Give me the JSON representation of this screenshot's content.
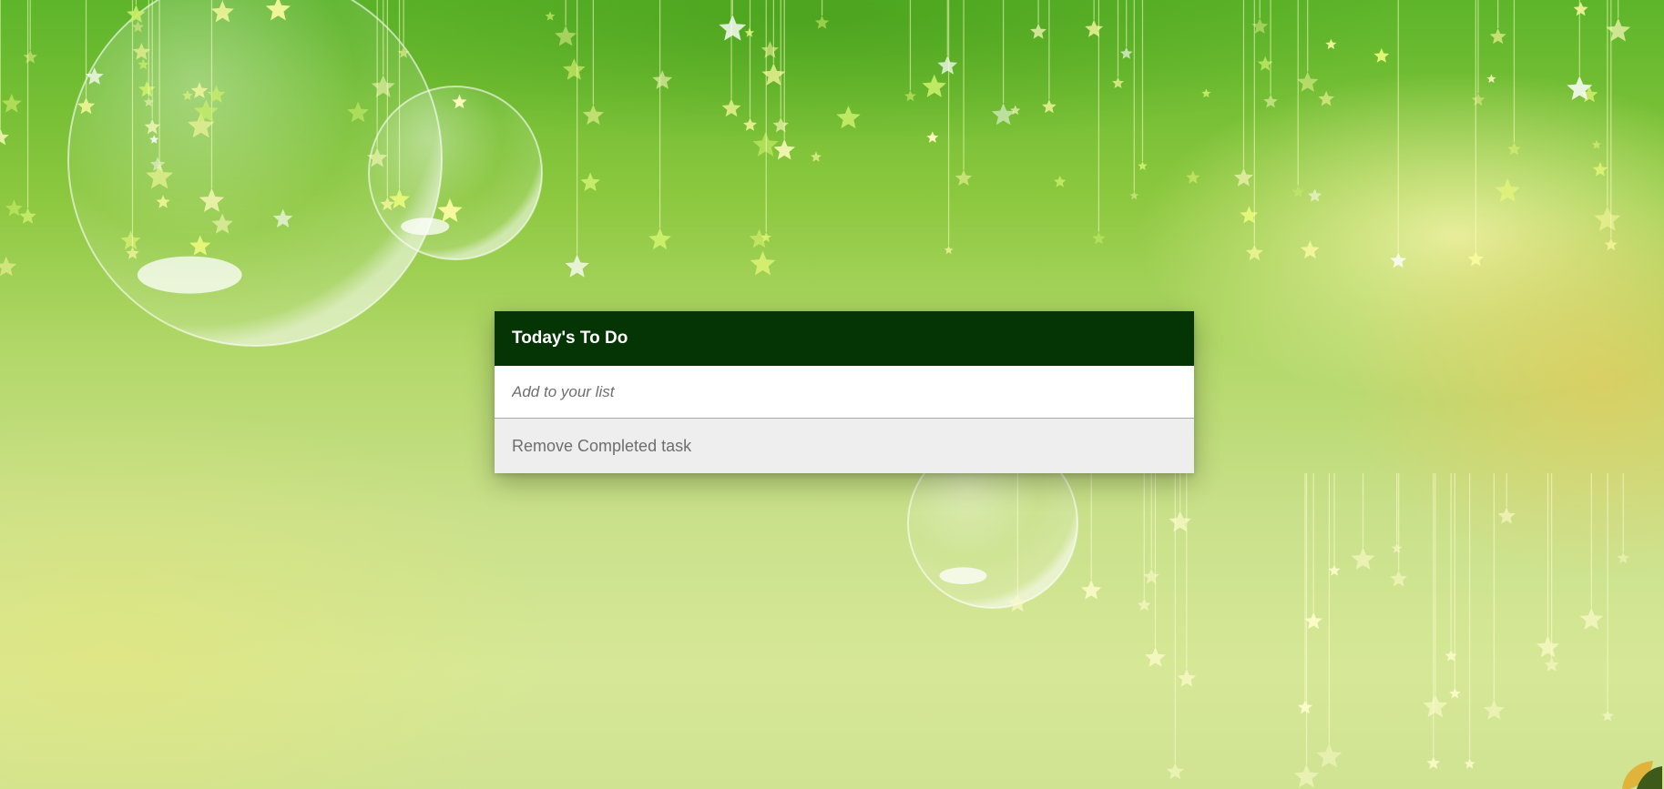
{
  "todo": {
    "title": "Today's To Do",
    "add_placeholder": "Add to your list",
    "add_value": "",
    "remove_label": "Remove Completed task"
  },
  "colors": {
    "header_bg": "#053405",
    "header_text": "#ffffff",
    "input_bg": "#ffffff",
    "remove_bg": "#eeeeee",
    "remove_text": "#6e6e6e",
    "background_theme": "#8cc83f"
  },
  "background": {
    "decorations": [
      "bubble",
      "hanging-star"
    ]
  }
}
